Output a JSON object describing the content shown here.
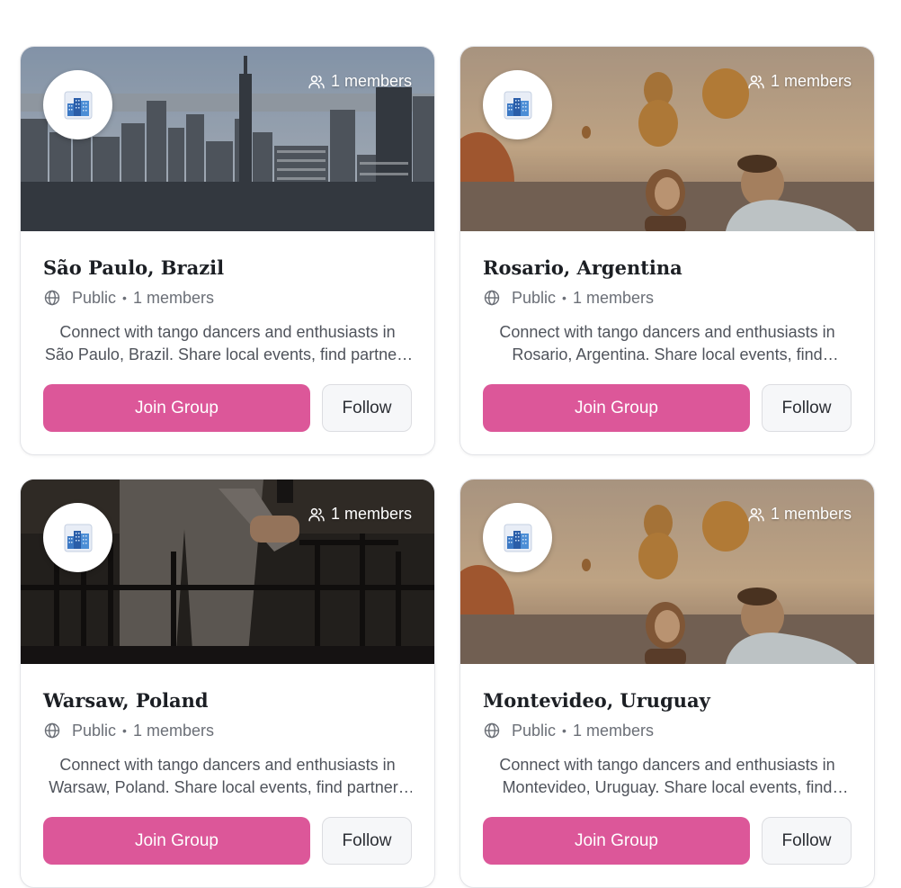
{
  "groups": [
    {
      "name": "São Paulo, Brazil",
      "members_badge": "1 members",
      "visibility": "Public",
      "separator": "•",
      "member_count": "1 members",
      "description": "Connect with tango dancers and enthusiasts in São Paulo, Brazil. Share local events, find partners and discover milongas.",
      "join_label": "Join Group",
      "follow_label": "Follow",
      "cover": "city-skyline"
    },
    {
      "name": "Rosario, Argentina",
      "members_badge": "1 members",
      "visibility": "Public",
      "separator": "•",
      "member_count": "1 members",
      "description": "Connect with tango dancers and enthusiasts in Rosario, Argentina. Share local events, find partners and discover milongas.",
      "join_label": "Join Group",
      "follow_label": "Follow",
      "cover": "balloons-couple"
    },
    {
      "name": "Warsaw, Poland",
      "members_badge": "1 members",
      "visibility": "Public",
      "separator": "•",
      "member_count": "1 members",
      "description": "Connect with tango dancers and enthusiasts in Warsaw, Poland. Share local events, find partners and discover milongas.",
      "join_label": "Join Group",
      "follow_label": "Follow",
      "cover": "dark-chairs"
    },
    {
      "name": "Montevideo, Uruguay",
      "members_badge": "1 members",
      "visibility": "Public",
      "separator": "•",
      "member_count": "1 members",
      "description": "Connect with tango dancers and enthusiasts in Montevideo, Uruguay. Share local events, find partners and discover milongas.",
      "join_label": "Join Group",
      "follow_label": "Follow",
      "cover": "balloons-couple"
    }
  ],
  "colors": {
    "join_button": "#dc5799",
    "follow_button_bg": "#f6f7f9",
    "muted_text": "#6b6f77",
    "title_text": "#1c1f24"
  },
  "icons": {
    "members": "users-icon",
    "visibility": "globe-icon",
    "avatar": "city-buildings-icon"
  }
}
